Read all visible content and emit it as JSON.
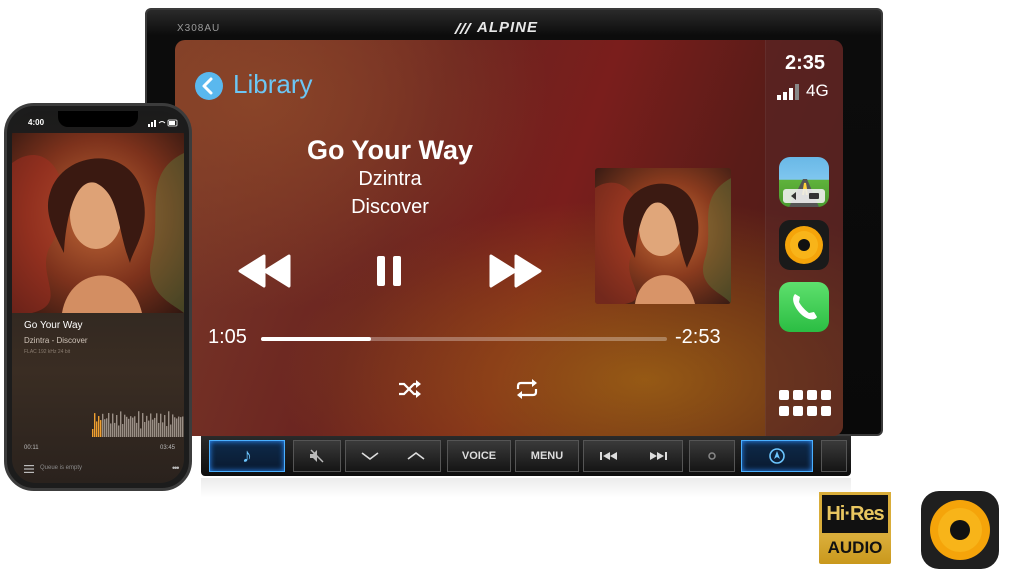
{
  "head_unit": {
    "model": "X308AU",
    "brand": "ALPINE",
    "status": {
      "time": "2:35",
      "network": "4G"
    },
    "nav": {
      "back_label": "Library"
    },
    "now_playing": {
      "title": "Go Your Way",
      "artist": "Dzintra",
      "album": "Discover",
      "elapsed": "1:05",
      "remaining": "-2:53",
      "progress": 0.27
    },
    "carplay_apps": [
      "maps-app-icon",
      "music-app-icon",
      "phone-app-icon",
      "app-grid-icon"
    ],
    "buttons": {
      "music": "♪",
      "mute": "mute-icon",
      "down": "chevron-down-icon",
      "up": "chevron-up-icon",
      "voice": "VOICE",
      "menu": "MENU",
      "prev": "prev-track-icon",
      "next": "next-track-icon",
      "nav": "nav-icon"
    },
    "colors": {
      "accent": "#5ab8ee",
      "button_glow": "#4ab0ff"
    }
  },
  "phone": {
    "time": "4:00",
    "title": "Go Your Way",
    "subtitle": "Dzintra - Discover",
    "format": "FLAC 192 kHz 24 bit",
    "elapsed": "00:11",
    "duration": "03:45",
    "queue": "Queue is empty"
  },
  "badges": {
    "hires_top": "Hi·Res",
    "hires_bottom": "AUDIO"
  }
}
